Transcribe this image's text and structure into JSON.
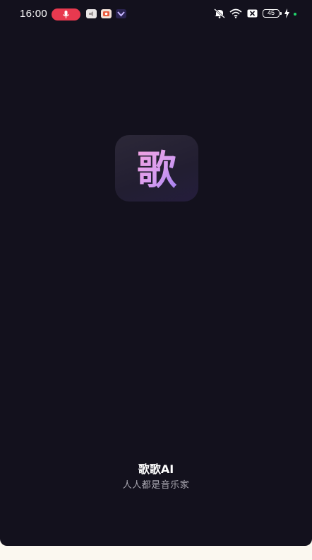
{
  "status_bar": {
    "time": "16:00",
    "battery_level": "45",
    "icons": [
      "mic-icon",
      "notification-icon",
      "notification-icon",
      "notification-icon",
      "mute-icon",
      "wifi-icon",
      "close-icon",
      "battery-icon",
      "charging-bolt-icon"
    ]
  },
  "splash": {
    "logo_text": "歌",
    "app_name": "歌歌AI",
    "slogan": "人人都是音乐家"
  },
  "colors": {
    "background": "#13111d",
    "mic_pill": "#e8394f",
    "logo_gradient_start": "#e98fd8",
    "logo_gradient_end": "#9b7bf0",
    "charging_dot": "#22d36b"
  }
}
